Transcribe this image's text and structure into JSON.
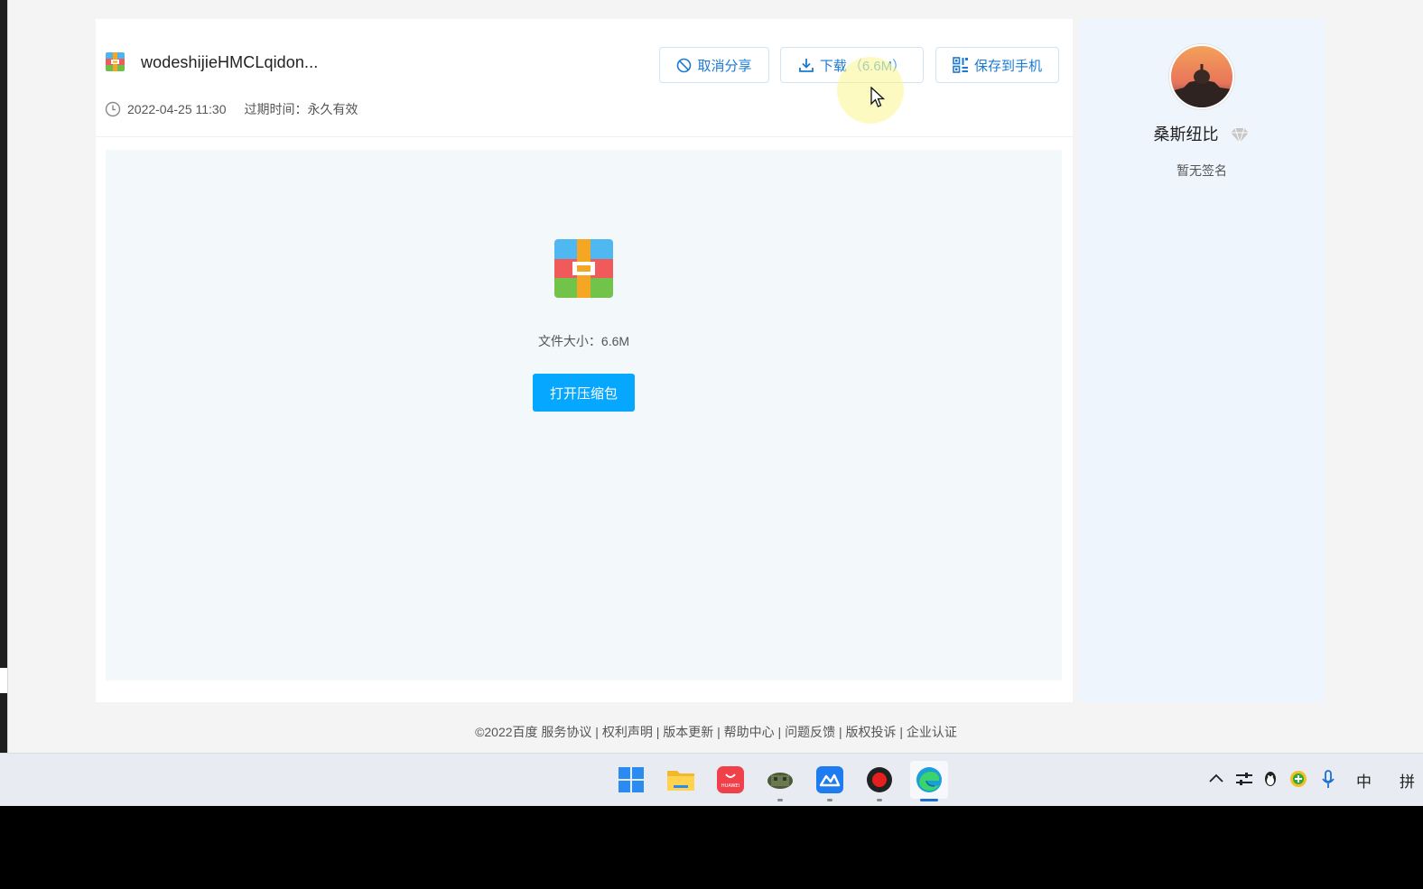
{
  "file": {
    "name": "wodeshijieHMCLqidon...",
    "date": "2022-04-25 11:30",
    "expire": "过期时间：永久有效",
    "size_label": "文件大小：6.6M"
  },
  "buttons": {
    "cancel_share": "取消分享",
    "download": "下载",
    "download_size": "（6.6M）",
    "save_phone": "保存到手机",
    "open_archive": "打开压缩包"
  },
  "user": {
    "name": "桑斯纽比",
    "signature": "暂无签名"
  },
  "footer": "©2022百度 服务协议 | 权利声明 | 版本更新 | 帮助中心 | 问题反馈 | 版权投诉 | 企业认证",
  "taskbar": {
    "apps": [
      "windows-start",
      "file-explorer",
      "huawei-appgallery",
      "minecraft",
      "feishu",
      "screen-recorder",
      "edge"
    ],
    "huawei_label": "HUAWEI",
    "tray_ime_mode": "中",
    "tray_ime_name": "拼"
  },
  "colors": {
    "accent": "#06a7ff",
    "link_blue": "#1a7ad4",
    "preview_bg": "#f3f8fb",
    "side_bg": "#eef5fd"
  }
}
